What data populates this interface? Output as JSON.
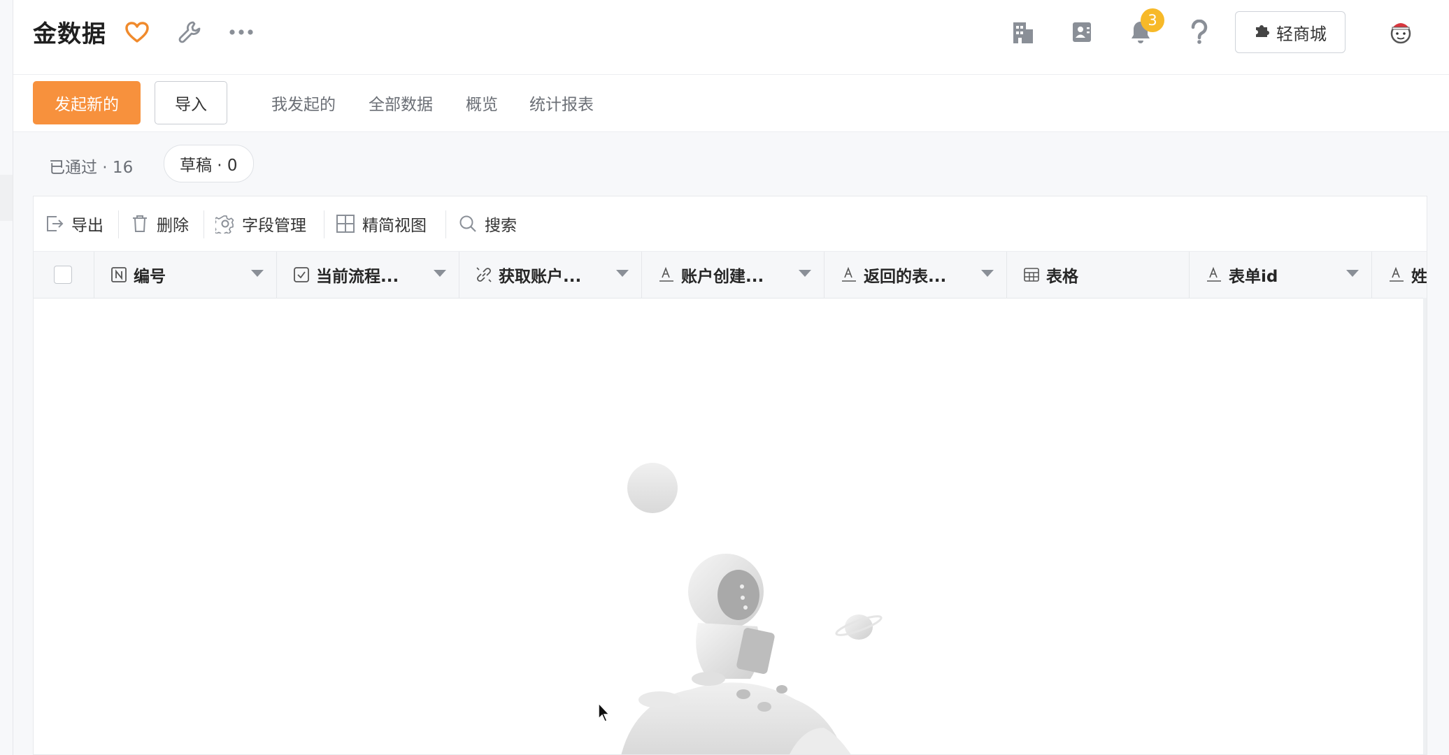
{
  "header": {
    "title": "金数据",
    "notification_count": "3",
    "mall_label": "轻商城"
  },
  "actions": {
    "new_label": "发起新的",
    "import_label": "导入",
    "tabs": [
      "我发起的",
      "全部数据",
      "概览",
      "统计报表"
    ]
  },
  "status": {
    "approved": "已通过 · 16",
    "draft": "草稿 · 0"
  },
  "toolbar": {
    "export": "导出",
    "delete": "删除",
    "fields": "字段管理",
    "compact_view": "精简视图",
    "search": "搜索"
  },
  "table": {
    "columns": [
      {
        "label": "编号",
        "icon": "number-icon"
      },
      {
        "label": "当前流程...",
        "icon": "checkbox-icon"
      },
      {
        "label": "获取账户...",
        "icon": "link-icon"
      },
      {
        "label": "账户创建...",
        "icon": "text-icon"
      },
      {
        "label": "返回的表...",
        "icon": "text-icon"
      },
      {
        "label": "表格",
        "icon": "table-icon"
      },
      {
        "label": "表单id",
        "icon": "text-icon"
      },
      {
        "label": "姓",
        "icon": "text-icon"
      }
    ]
  },
  "colors": {
    "accent": "#f7913d",
    "badge": "#f7b928",
    "heart": "#f08a2c"
  }
}
